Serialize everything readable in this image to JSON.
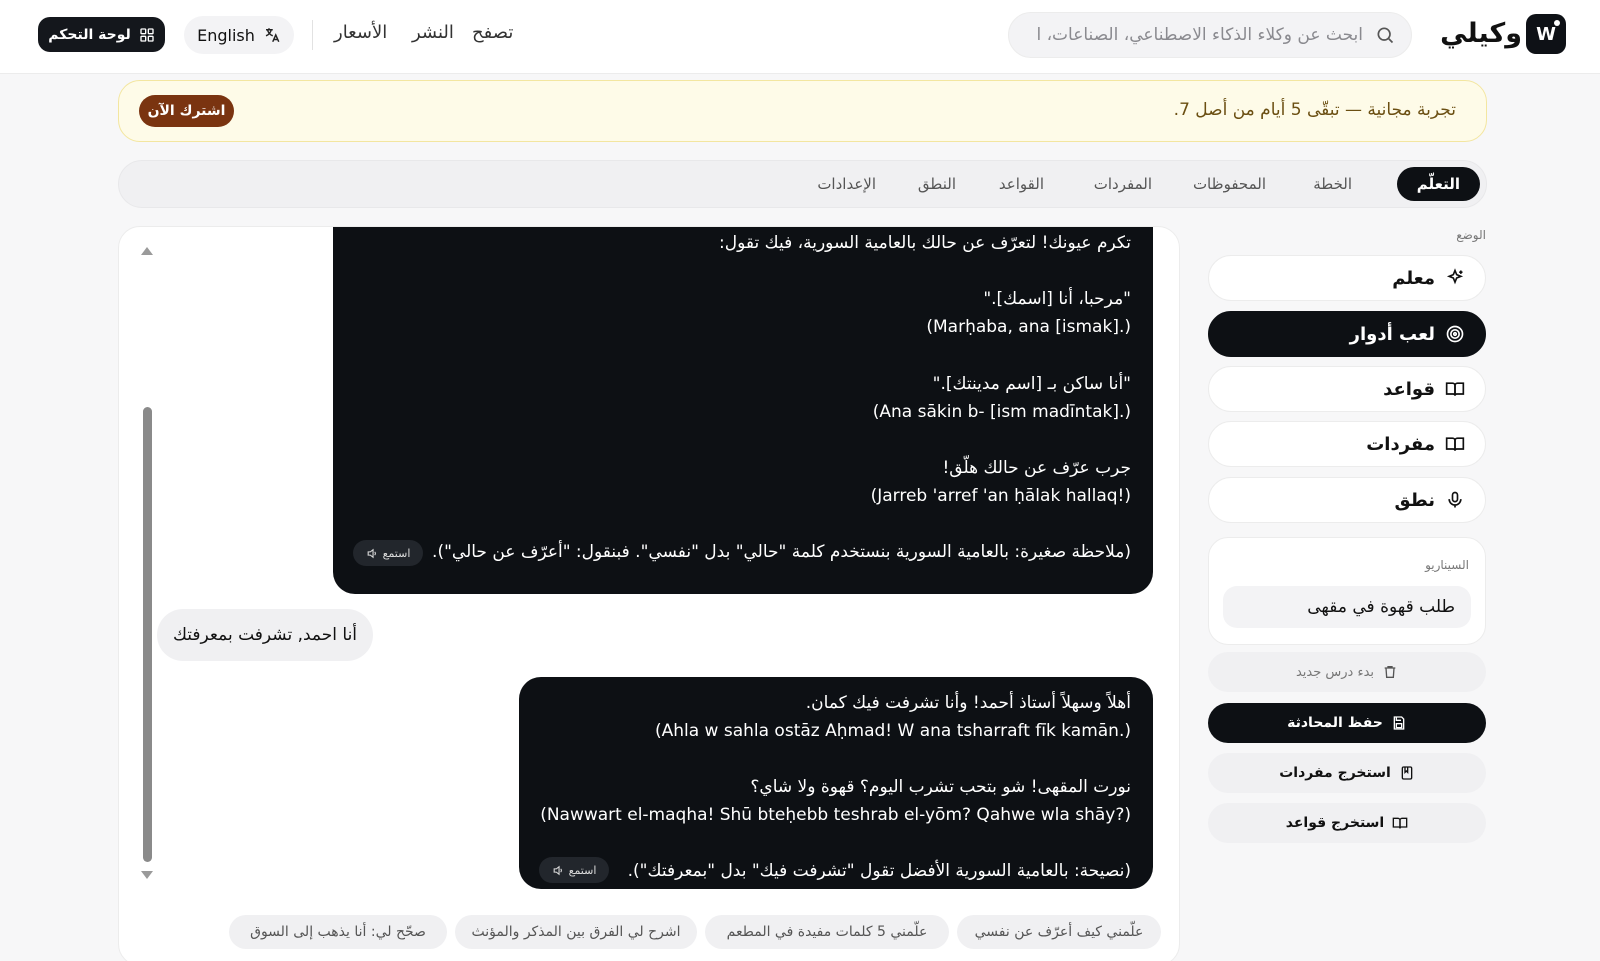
{
  "header": {
    "brand": "وكيلي",
    "logo_letter": "W",
    "search_placeholder": "ابحث عن وكلاء الذكاء الاصطناعي، الصناعات، ا",
    "nav": [
      "تصفح",
      "النشر",
      "الأسعار"
    ],
    "language_label": "English",
    "dashboard_label": "لوحة التحكم"
  },
  "banner": {
    "text": "تجربة مجانية — تبقّى 5 أيام من أصل 7.",
    "subscribe_label": "اشترك الآن"
  },
  "tabs": [
    "التعلّم",
    "الخطة",
    "المحفوظات",
    "المفردات",
    "القواعد",
    "النطق",
    "الإعدادات"
  ],
  "sidebar": {
    "mode_label": "الوضع",
    "modes": [
      {
        "label": "معلم",
        "icon": "sparkles-icon"
      },
      {
        "label": "لعب أدوار",
        "icon": "target-icon"
      },
      {
        "label": "قواعد",
        "icon": "book-icon"
      },
      {
        "label": "مفردات",
        "icon": "book-icon"
      },
      {
        "label": "نطق",
        "icon": "mic-icon"
      }
    ],
    "scenario_label": "السيناريو",
    "scenario_value": "طلب قهوة في مقهى",
    "new_lesson": "بدء درس جديد",
    "save_chat": "حفظ المحادثة",
    "extract_vocab": "استخرج مفردات",
    "extract_grammar": "استخرج قواعد"
  },
  "chat": {
    "msg1_lines": [
      "تكرم عيونك! لتعرّف عن حالك بالعامية السورية، فيك تقول:",
      "\"مرحبا، أنا [اسمك].\"",
      "(Marḥaba, ana [ismak].)",
      "\"أنا ساكن بـ [اسم مدينتك].\"",
      "(Ana sākin b- [ism madīntak].)",
      "جرب عرّف عن حالك هلّق!",
      "(Jarreb 'arref 'an ḥālak hallaq!)",
      "(ملاحظة صغيرة: بالعامية السورية بنستخدم كلمة \"حالي\" بدل \"نفسي\". فبنقول: \"أعرّف عن حالي\")."
    ],
    "listen_label": "استمع",
    "user_msg": "أنا احمد, تشرفت بمعرفتك",
    "msg2_lines": [
      "أهلاً وسهلاً أستاذ أحمد! وأنا تشرفت فيك كمان.",
      "(Ahla w sahla ostāz Aḥmad! W ana tsharraft fīk kamān.)",
      "نورت المقهى! شو بتحب تشرب اليوم؟ قهوة ولا شاي؟",
      "(Nawwart el-maqha! Shū bteḥebb teshrab el-yōm? Qahwe wla shāy?)",
      "(نصيحة: بالعامية السورية الأفضل تقول \"تشرفت فيك\" بدل \"بمعرفتك\")."
    ],
    "suggestions": [
      "علّمني كيف أعرّف عن نفسي",
      "علّمني 5 كلمات مفيدة في المطعم",
      "اشرح لي الفرق بين المذكر والمؤنث",
      "صحّح لي: أنا يذهب إلى السوق"
    ]
  },
  "colors": {
    "accent_dark": "#0d1014",
    "banner_bg": "#fefbe8",
    "subscribe_bg": "#7a3410"
  }
}
